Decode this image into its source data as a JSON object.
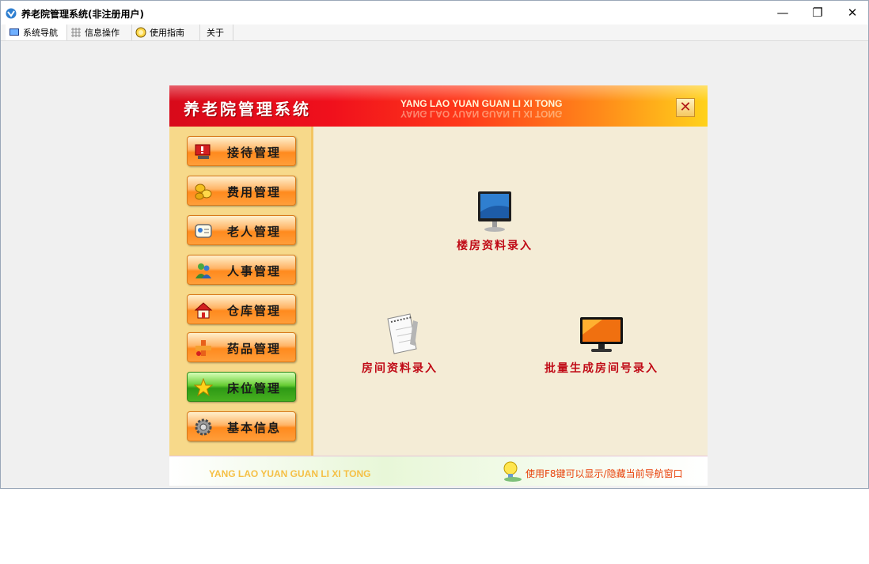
{
  "window": {
    "title": "养老院管理系统(非注册用户)",
    "controls": {
      "minimize": "—",
      "maximize": "❐",
      "close": "✕"
    }
  },
  "menu": {
    "items": [
      {
        "label": "系统导航",
        "icon": "monitor-icon",
        "active": true
      },
      {
        "label": "信息操作",
        "icon": "grid-icon",
        "active": false
      },
      {
        "label": "使用指南",
        "icon": "help-icon",
        "active": false
      },
      {
        "label": "关于",
        "icon": "",
        "active": false
      }
    ]
  },
  "panel": {
    "title": "养老院管理系统",
    "subtitle": "YANG LAO YUAN GUAN LI XI TONG",
    "close_label": "✕"
  },
  "sidebar": {
    "items": [
      {
        "label": "接待管理",
        "icon": "reception-icon",
        "active": false
      },
      {
        "label": "费用管理",
        "icon": "coins-icon",
        "active": false
      },
      {
        "label": "老人管理",
        "icon": "contact-card-icon",
        "active": false
      },
      {
        "label": "人事管理",
        "icon": "people-icon",
        "active": false
      },
      {
        "label": "仓库管理",
        "icon": "house-icon",
        "active": false
      },
      {
        "label": "药品管理",
        "icon": "medicine-icon",
        "active": false
      },
      {
        "label": "床位管理",
        "icon": "star-icon",
        "active": true
      },
      {
        "label": "基本信息",
        "icon": "gear-icon",
        "active": false
      }
    ]
  },
  "functions": {
    "building": {
      "label": "楼房资料录入",
      "icon": "monitor-icon"
    },
    "room": {
      "label": "房间资料录入",
      "icon": "notepad-icon"
    },
    "batch": {
      "label": "批量生成房间号录入",
      "icon": "widescreen-monitor-icon"
    }
  },
  "footer": {
    "left": "YANG LAO YUAN GUAN LI XI TONG",
    "hint": "使用F8键可以显示/隐藏当前导航窗口",
    "icon": "lightbulb-icon"
  },
  "colors": {
    "header_start": "#d80a1a",
    "header_end": "#ffd21a",
    "function_label": "#c00a16",
    "hint_text": "#e8420a",
    "active_button": "#48b020"
  }
}
